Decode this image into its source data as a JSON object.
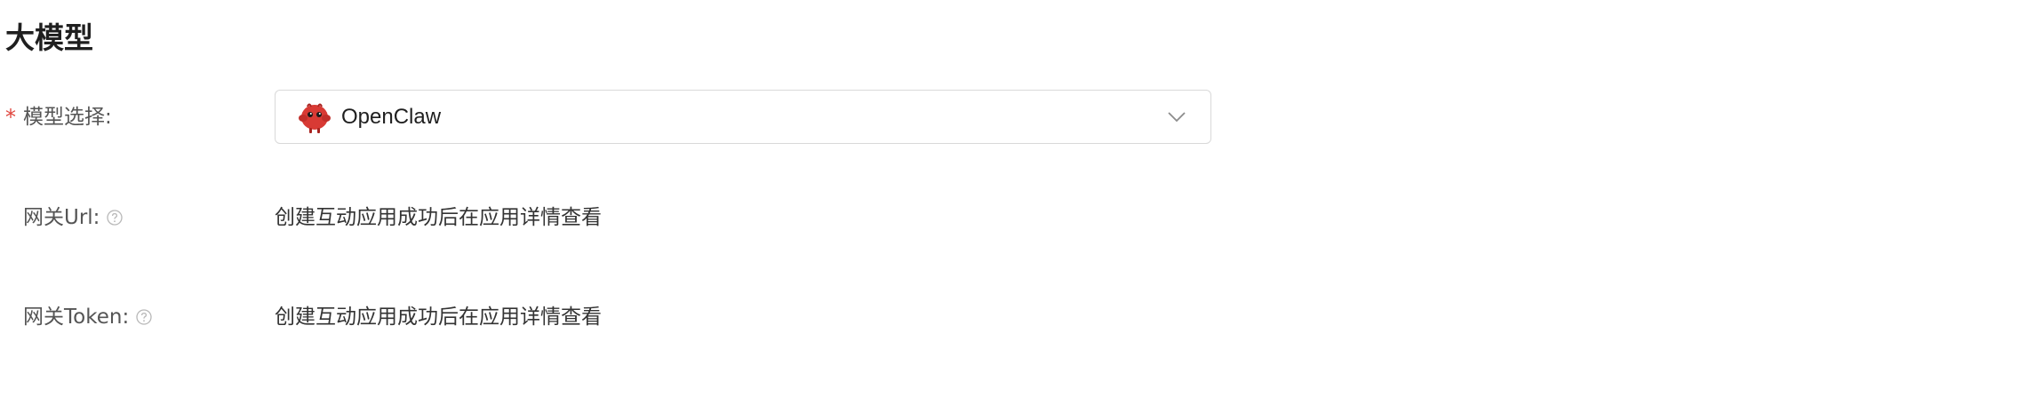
{
  "section": {
    "title": "大模型"
  },
  "model_select": {
    "required_mark": "*",
    "label": "模型选择:",
    "selected_value": "OpenClaw",
    "selected_icon": "red-creature-avatar-icon",
    "dropdown_icon": "chevron-down-icon"
  },
  "gateway_url": {
    "label": "网关Url:",
    "help_icon": "question-circle-icon",
    "value": "创建互动应用成功后在应用详情查看"
  },
  "gateway_token": {
    "label": "网关Token:",
    "help_icon": "question-circle-icon",
    "value": "创建互动应用成功后在应用详情查看"
  },
  "colors": {
    "required": "#e0463e",
    "border": "#d9d9d9",
    "title": "#1f1f1f",
    "label": "#555555",
    "avatar": "#d83a34"
  }
}
